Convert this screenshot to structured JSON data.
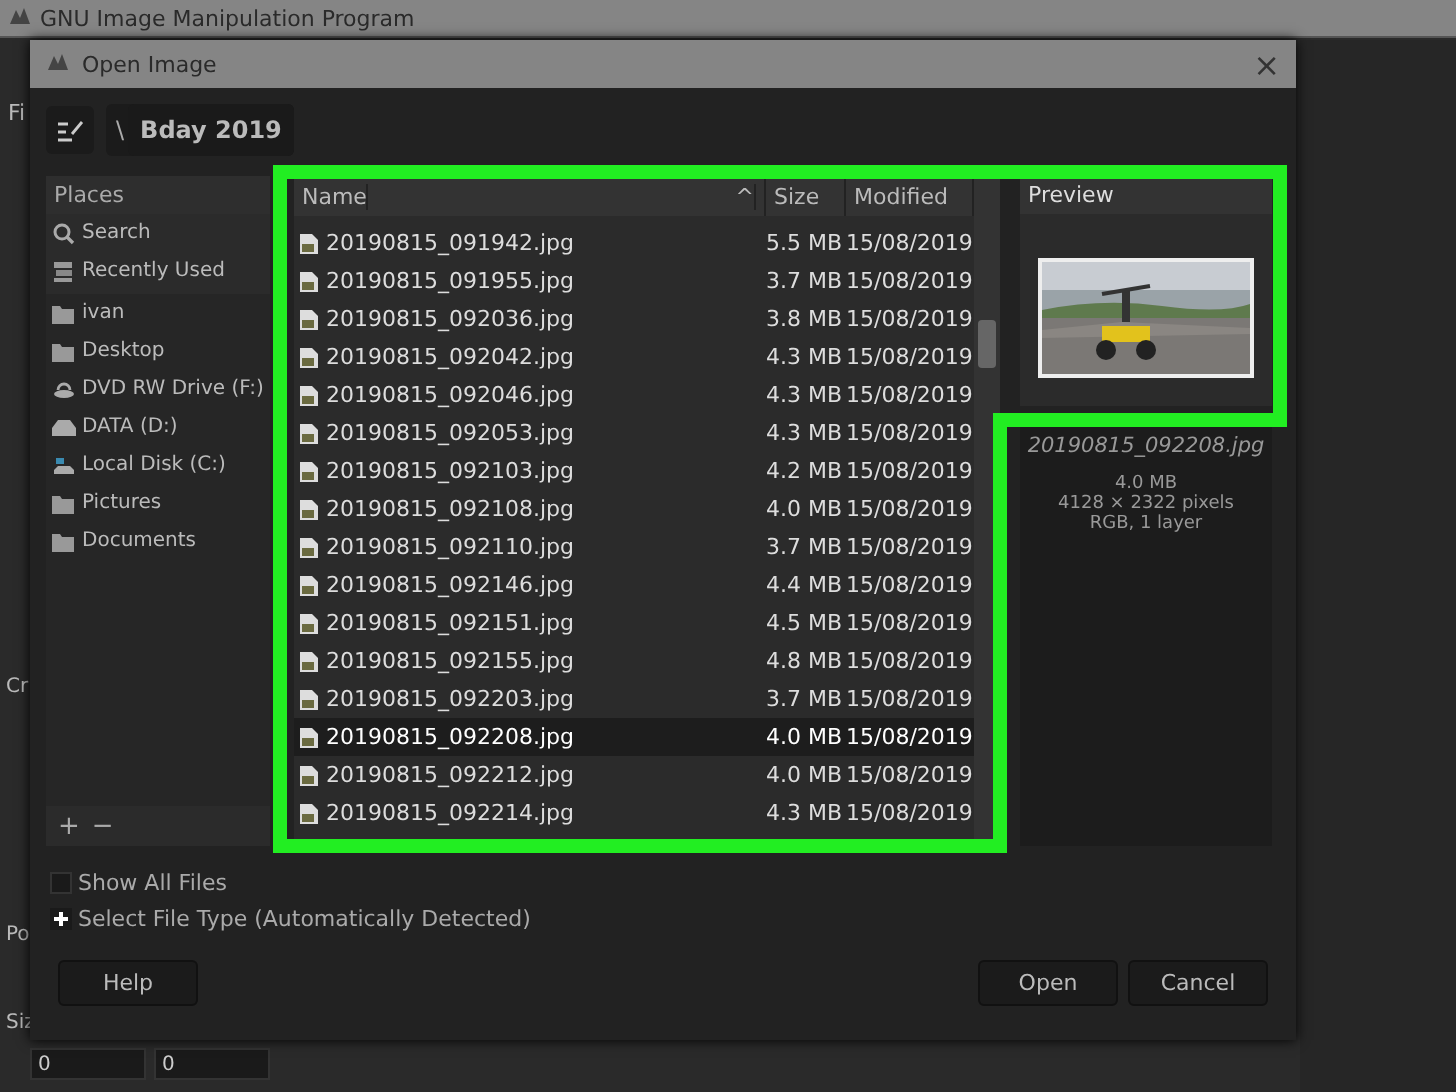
{
  "main_window": {
    "title": "GNU Image Manipulation Program",
    "menu_fragment": "Fi",
    "panel_labels": [
      "Cr",
      "Po",
      "Siz"
    ],
    "spinners": [
      "0",
      "0"
    ]
  },
  "dialog": {
    "title": "Open Image",
    "close": "×",
    "path": {
      "separator": "\\",
      "folder": "Bday 2019"
    },
    "places": {
      "heading": "Places",
      "items": [
        {
          "kind": "search",
          "label": "Search"
        },
        {
          "kind": "recent",
          "label": "Recently Used"
        },
        {
          "kind": "folder",
          "label": "ivan"
        },
        {
          "kind": "folder",
          "label": "Desktop"
        },
        {
          "kind": "optical",
          "label": "DVD RW Drive (F:)"
        },
        {
          "kind": "drive",
          "label": "DATA (D:)"
        },
        {
          "kind": "system",
          "label": "Local Disk (C:)"
        },
        {
          "kind": "folder",
          "label": "Pictures"
        },
        {
          "kind": "folder",
          "label": "Documents"
        }
      ],
      "add": "+",
      "remove": "−"
    },
    "files": {
      "columns": [
        "Name",
        "Size",
        "Modified"
      ],
      "sort_mark": "^",
      "rows": [
        {
          "name": "20190815_091942.jpg",
          "size": "5.5 MB",
          "modified": "15/08/2019",
          "selected": false
        },
        {
          "name": "20190815_091955.jpg",
          "size": "3.7 MB",
          "modified": "15/08/2019",
          "selected": false
        },
        {
          "name": "20190815_092036.jpg",
          "size": "3.8 MB",
          "modified": "15/08/2019",
          "selected": false
        },
        {
          "name": "20190815_092042.jpg",
          "size": "4.3 MB",
          "modified": "15/08/2019",
          "selected": false
        },
        {
          "name": "20190815_092046.jpg",
          "size": "4.3 MB",
          "modified": "15/08/2019",
          "selected": false
        },
        {
          "name": "20190815_092053.jpg",
          "size": "4.3 MB",
          "modified": "15/08/2019",
          "selected": false
        },
        {
          "name": "20190815_092103.jpg",
          "size": "4.2 MB",
          "modified": "15/08/2019",
          "selected": false
        },
        {
          "name": "20190815_092108.jpg",
          "size": "4.0 MB",
          "modified": "15/08/2019",
          "selected": false
        },
        {
          "name": "20190815_092110.jpg",
          "size": "3.7 MB",
          "modified": "15/08/2019",
          "selected": false
        },
        {
          "name": "20190815_092146.jpg",
          "size": "4.4 MB",
          "modified": "15/08/2019",
          "selected": false
        },
        {
          "name": "20190815_092151.jpg",
          "size": "4.5 MB",
          "modified": "15/08/2019",
          "selected": false
        },
        {
          "name": "20190815_092155.jpg",
          "size": "4.8 MB",
          "modified": "15/08/2019",
          "selected": false
        },
        {
          "name": "20190815_092203.jpg",
          "size": "3.7 MB",
          "modified": "15/08/2019",
          "selected": false
        },
        {
          "name": "20190815_092208.jpg",
          "size": "4.0 MB",
          "modified": "15/08/2019",
          "selected": true
        },
        {
          "name": "20190815_092212.jpg",
          "size": "4.0 MB",
          "modified": "15/08/2019",
          "selected": false
        },
        {
          "name": "20190815_092214.jpg",
          "size": "4.3 MB",
          "modified": "15/08/2019",
          "selected": false
        }
      ]
    },
    "preview": {
      "heading": "Preview",
      "filename": "20190815_092208.jpg",
      "info": [
        "4.0 MB",
        "4128 × 2322 pixels",
        "RGB, 1 layer"
      ]
    },
    "show_all_files": {
      "label": "Show All Files",
      "checked": false
    },
    "file_type": {
      "label": "Select File Type (Automatically Detected)",
      "expanded": false
    },
    "buttons": [
      "Help",
      "Open",
      "Cancel"
    ]
  },
  "annotation": {
    "kind": "outline"
  }
}
